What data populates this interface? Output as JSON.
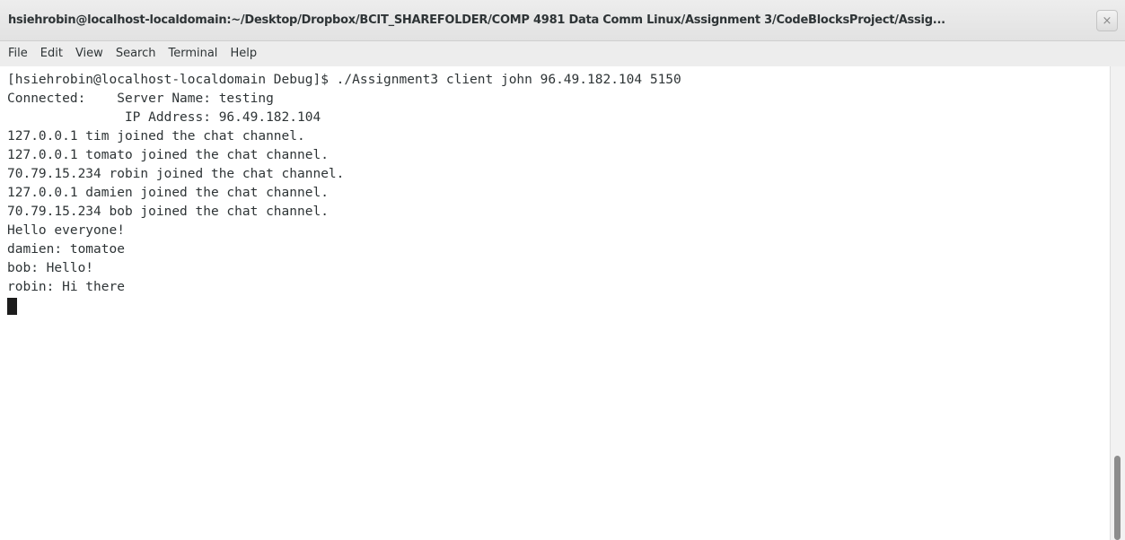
{
  "window": {
    "title": "hsiehrobin@localhost-localdomain:~/Desktop/Dropbox/BCIT_SHAREFOLDER/COMP 4981 Data Comm Linux/Assignment 3/CodeBlocksProject/Assig...",
    "close_label": "×"
  },
  "menu": {
    "items": [
      "File",
      "Edit",
      "View",
      "Search",
      "Terminal",
      "Help"
    ]
  },
  "terminal": {
    "lines": [
      "[hsiehrobin@localhost-localdomain Debug]$ ./Assignment3 client john 96.49.182.104 5150",
      "Connected:    Server Name: testing",
      "               IP Address: 96.49.182.104",
      "127.0.0.1 tim joined the chat channel.",
      "127.0.0.1 tomato joined the chat channel.",
      "70.79.15.234 robin joined the chat channel.",
      "127.0.0.1 damien joined the chat channel.",
      "70.79.15.234 bob joined the chat channel.",
      "Hello everyone!",
      "damien: tomatoe",
      "bob: Hello!",
      "robin: Hi there"
    ]
  },
  "scrollbar": {
    "position_fraction": 1.0
  }
}
